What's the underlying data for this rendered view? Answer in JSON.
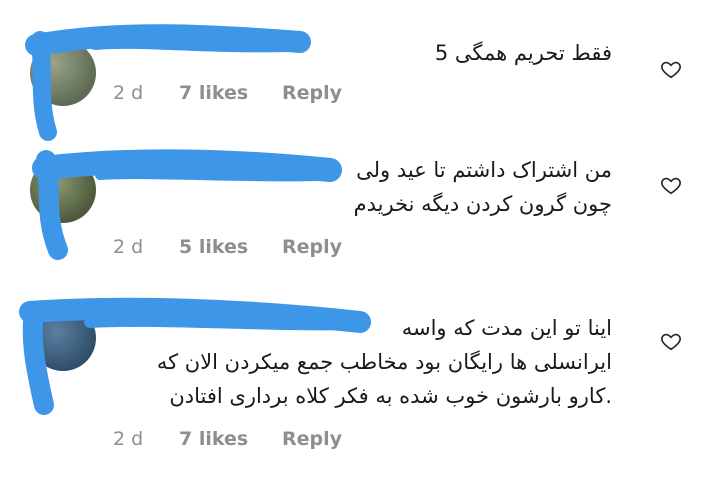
{
  "comments": [
    {
      "lines": [
        "فقط تحریم همگی 5"
      ],
      "time": "2 d",
      "likes": "7 likes",
      "reply": "Reply"
    },
    {
      "lines": [
        "من اشتراک داشتم تا عید ولی",
        "چون گرون کردن دیگه نخریدم"
      ],
      "time": "2 d",
      "likes": "5 likes",
      "reply": "Reply"
    },
    {
      "lines": [
        "اینا تو این مدت که واسه",
        "ایرانسلی ها رایگان بود مخاطب جمع میکردن الان که",
        ".کارو بارشون خوب شده به فکر کلاه برداری افتادن"
      ],
      "time": "2 d",
      "likes": "7 likes",
      "reply": "Reply"
    }
  ],
  "icons": {
    "like": "heart-outline-icon"
  },
  "colors": {
    "redaction": "#3d96e8",
    "meta": "#8e8e8e",
    "text": "#1a1a1a"
  }
}
